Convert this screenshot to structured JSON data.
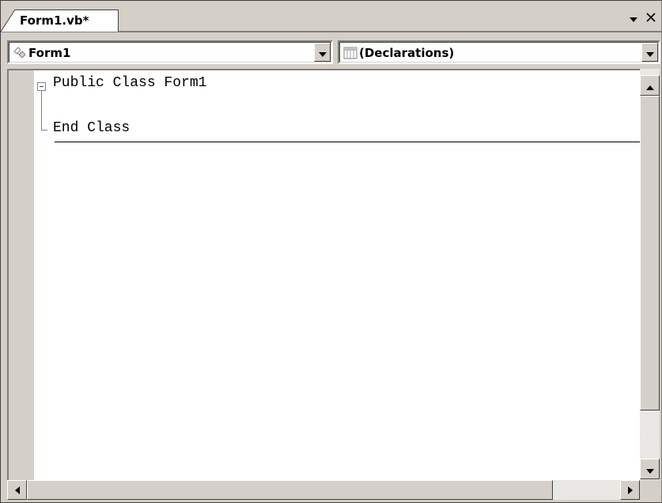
{
  "tab": {
    "label": "Form1.vb*"
  },
  "window_buttons": {
    "menu_glyph": "▾",
    "close_glyph": "✕"
  },
  "object_combo": {
    "value": "Form1",
    "icon": "class-icon"
  },
  "member_combo": {
    "value": "(Declarations)",
    "icon": "declarations-icon"
  },
  "code_lines": [
    "Public Class Form1",
    "End Class"
  ],
  "colors": {
    "chrome": "#d4d0c8",
    "editor_bg": "#ffffff",
    "text": "#000000"
  }
}
